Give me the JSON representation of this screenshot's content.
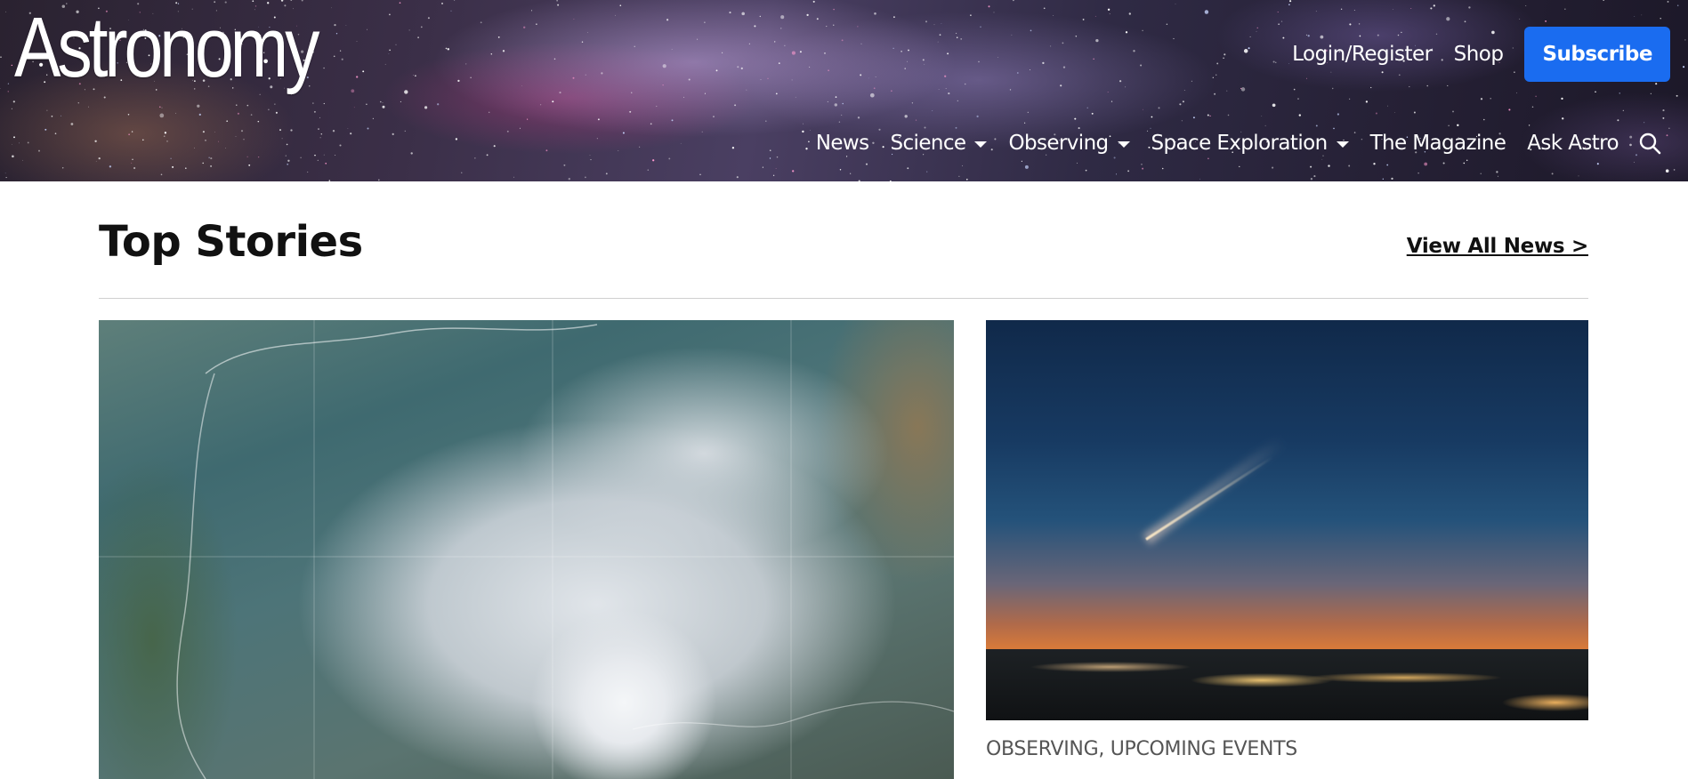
{
  "header": {
    "logo_text": "Astronomy",
    "top_links": {
      "login": "Login/Register",
      "shop": "Shop",
      "subscribe": "Subscribe"
    },
    "nav": {
      "news": "News",
      "science": "Science",
      "observing": "Observing",
      "space_exploration": "Space Exploration",
      "magazine": "The Magazine",
      "ask_astro": "Ask Astro"
    },
    "icons": {
      "search": "search-icon",
      "dropdown": "caret-down-icon"
    }
  },
  "main": {
    "section_title": "Top Stories",
    "view_all": "View All News >",
    "side_story": {
      "category": "OBSERVING, UPCOMING EVENTS"
    }
  },
  "colors": {
    "accent": "#1a6cf0",
    "nav_text": "#ffffff",
    "title_text": "#111111",
    "category_text": "#555555"
  }
}
